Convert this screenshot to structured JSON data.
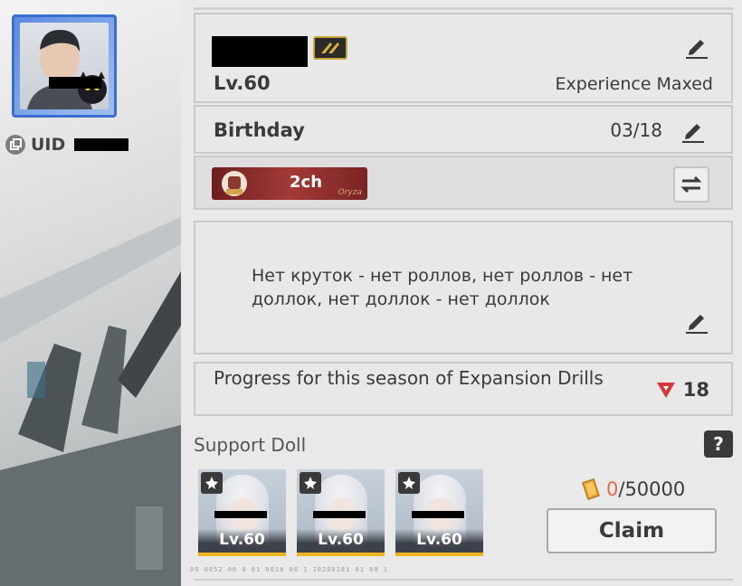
{
  "profile": {
    "uid_label": "UID",
    "level": "Lv.60",
    "experience_status": "Experience Maxed",
    "birthday_label": "Birthday",
    "birthday_value": "03/18",
    "badge_text": "2ch",
    "signature": "Нет круток - нет роллов, нет роллов - нет доллок, нет доллок - нет доллок"
  },
  "progress": {
    "label": "Progress for this season of Expansion Drills",
    "value": "18"
  },
  "support": {
    "title": "Support Doll",
    "help_label": "?",
    "dolls": [
      {
        "level": "Lv.60"
      },
      {
        "level": "Lv.60"
      },
      {
        "level": "Lv.60"
      }
    ],
    "reward_current": "0",
    "reward_total": "/50000",
    "claim_label": "Claim"
  },
  "footer": {
    "code": "06 0052 00 0 01   0018   06   1     10200181    01  00  1"
  },
  "colors": {
    "accent_red": "#e8674d",
    "gold": "#f0b41e",
    "avatar_frame": "#3a6fd0"
  }
}
